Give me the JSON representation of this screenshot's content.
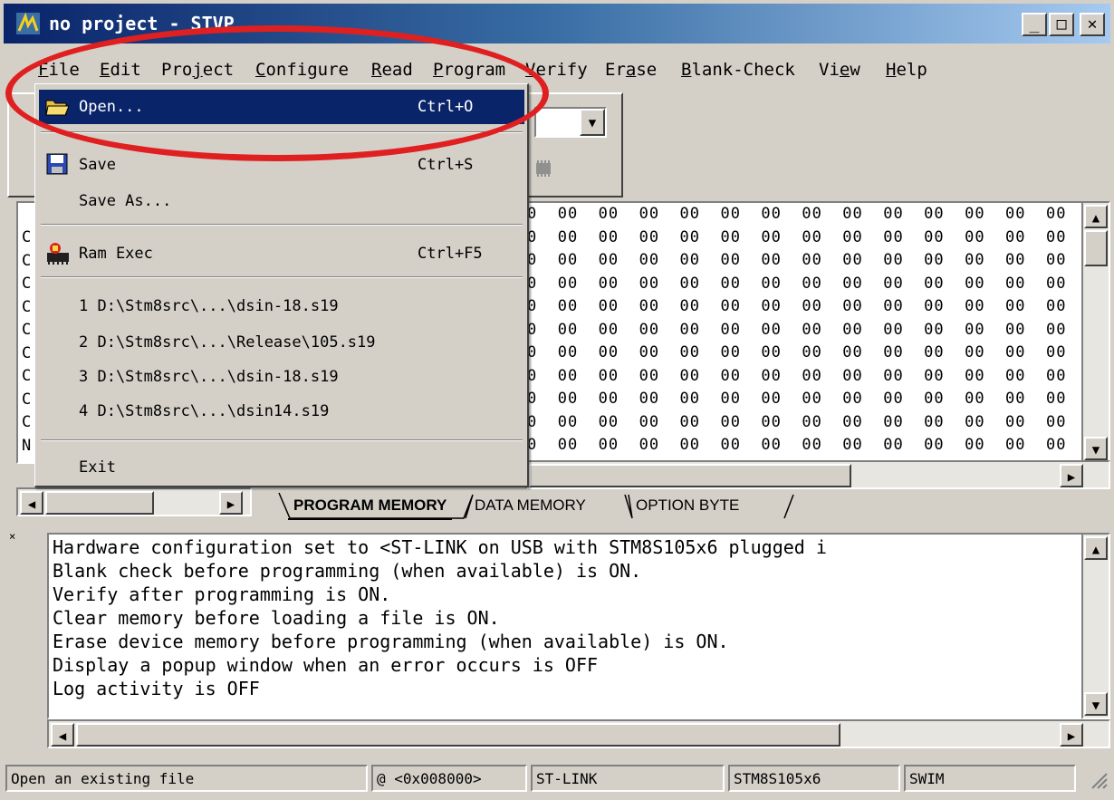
{
  "window": {
    "title": "no project - STVP"
  },
  "menubar": {
    "items": [
      {
        "label": "File",
        "u": "F",
        "rest": "ile"
      },
      {
        "label": "Edit",
        "u": "E",
        "rest": "dit"
      },
      {
        "label": "Project",
        "pre": "Pro",
        "u": "j",
        "rest": "ect"
      },
      {
        "label": "Configure",
        "u": "C",
        "rest": "onfigure"
      },
      {
        "label": "Read",
        "u": "R",
        "rest": "ead"
      },
      {
        "label": "Program",
        "u": "P",
        "rest": "rogram"
      },
      {
        "label": "Verify",
        "u": "V",
        "rest": "erify"
      },
      {
        "label": "Erase",
        "pre": "Er",
        "u": "a",
        "rest": "se"
      },
      {
        "label": "Blank-Check",
        "u": "B",
        "rest": "lank-Check"
      },
      {
        "label": "View",
        "pre": "Vi",
        "u": "e",
        "rest": "w"
      },
      {
        "label": "Help",
        "u": "H",
        "rest": "elp"
      }
    ]
  },
  "file_menu": {
    "open": {
      "label": "Open...",
      "shortcut": "Ctrl+O"
    },
    "save": {
      "label": "Save",
      "shortcut": "Ctrl+S"
    },
    "save_as": {
      "label": "Save As..."
    },
    "ram_exec": {
      "label": "Ram Exec",
      "shortcut": "Ctrl+F5"
    },
    "recent": [
      "1 D:\\Stm8src\\...\\dsin-18.s19",
      "2 D:\\Stm8src\\...\\Release\\105.s19",
      "3 D:\\Stm8src\\...\\dsin-18.s19",
      "4 D:\\Stm8src\\...\\dsin14.s19"
    ],
    "exit": {
      "label": "Exit"
    }
  },
  "hex_view": {
    "row_text": "0  00  00  00  00  00  00  00  00  00  00  00  00  00  00"
  },
  "left_panel": {
    "row_chars": [
      "C",
      "C",
      "C",
      "C",
      "C",
      "C",
      "C",
      "C",
      "C",
      "N"
    ]
  },
  "tabs": [
    "PROGRAM MEMORY",
    "DATA MEMORY",
    "OPTION BYTE"
  ],
  "log": [
    "Hardware configuration set to <ST-LINK on USB with STM8S105x6 plugged i",
    "Blank check before programming (when available) is ON.",
    "Verify after programming is ON.",
    "Clear memory before loading a file is ON.",
    "Erase device memory before programming (when available) is ON.",
    "Display a popup window when an error occurs is OFF",
    "Log activity is OFF"
  ],
  "statusbar": {
    "message": "Open an existing file",
    "address": "@ <0x008000>",
    "tool": "ST-LINK",
    "device": "STM8S105x6",
    "protocol": "SWIM"
  },
  "colors": {
    "titlebar_start": "#0a246a",
    "selection": "#0a246a",
    "annotation": "#e02020"
  }
}
